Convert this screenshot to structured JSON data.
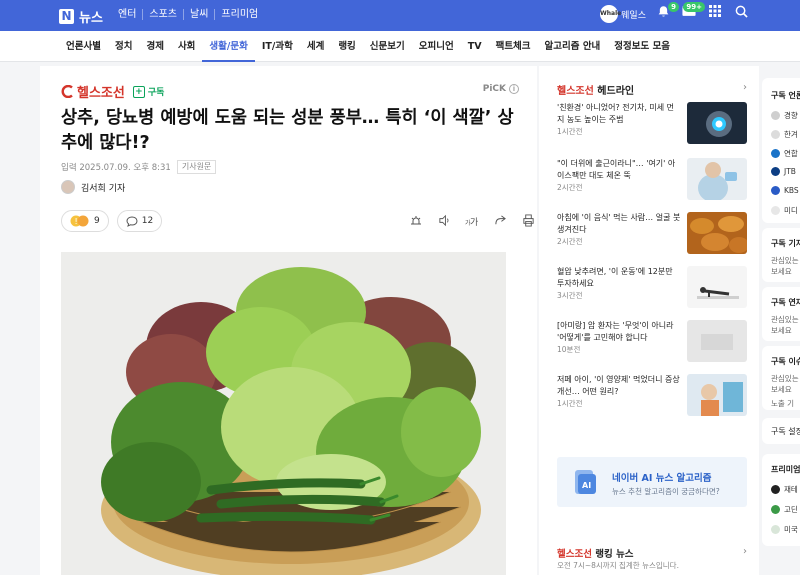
{
  "header": {
    "logo_letter": "N",
    "logo_text": "뉴스",
    "nav": [
      "엔터",
      "스포츠",
      "날씨",
      "프리미엄"
    ],
    "whale_label": "웨일스",
    "whale_logo": "Whale",
    "notif_badge": "9",
    "mail_badge": "99+"
  },
  "categories": [
    "언론사별",
    "정치",
    "경제",
    "사회",
    "생활/문화",
    "IT/과학",
    "세계",
    "랭킹",
    "신문보기",
    "오피니언",
    "TV",
    "팩트체크",
    "알고리즘 안내",
    "정정보도 모음"
  ],
  "active_category": "생활/문화",
  "article": {
    "press": "헬스조선",
    "subscribe": "구독",
    "pick": "PiCK",
    "headline": "상추, 당뇨병 예방에 도움 되는 성분 풍부… 특히 ‘이 색깔’ 상추에 많다!?",
    "date": "입력 2025.07.09. 오후 8:31",
    "original": "기사원문",
    "author": "김서희 기자",
    "reactions": "9",
    "comments": "12"
  },
  "sidebar": {
    "press": "헬스조선",
    "headline_label": "헤드라인",
    "items": [
      {
        "title": "'친환경' 아니었어? 전기차, 미세 먼지 농도 높이는 주범",
        "time": "1시간전"
      },
      {
        "title": "\"이 더위에 출근이라니\"… '여기' 아이스팩만 대도 체온 뚝",
        "time": "2시간전"
      },
      {
        "title": "아침에 '이 음식' 먹는 사람… 얼굴 붓 생겨진다",
        "time": "2시간전"
      },
      {
        "title": "혈압 낮추려면, '이 운동'에 12분만 투자하세요",
        "time": "3시간전"
      },
      {
        "title": "[아미랑] 암 환자는 '무엇'이 아니라 '어떻게'를 고민해야 합니다",
        "time": "10분전"
      },
      {
        "title": "저페 아이, '이 영양제' 먹었더니 증상 개선… 어떤 원리?",
        "time": "1시간전"
      }
    ],
    "ai_title": "네이버 AI 뉴스 알고리즘",
    "ai_sub": "뉴스 추천 알고리즘이 궁금하다면?",
    "ai_icon_text": "AI",
    "ranking_label": "랭킹 뉴스",
    "ranking_sub": "오전 7시~8시까지 집계한 뉴스입니다."
  },
  "far": {
    "box1_title": "구독 언론",
    "box1_items": [
      "경향",
      "한겨",
      "연합",
      "JTB",
      "KBS",
      "미디"
    ],
    "box2_title": "구독 기자",
    "box2_text": [
      "관심있는",
      "보세요"
    ],
    "box3_title": "구독 연재",
    "box3_text": [
      "관심있는",
      "보세요"
    ],
    "box4_title": "구독 이슈",
    "box4_text": [
      "관심있는",
      "보세요",
      "노출 기"
    ],
    "settings": "구독 설정",
    "box5_title": "프리미엄",
    "box5_items": [
      "재테",
      "고딘",
      "미국"
    ]
  },
  "colors": {
    "brand_blue": "#4266d8",
    "press_red": "#d4352b",
    "subscribe_green": "#0aa35a"
  }
}
